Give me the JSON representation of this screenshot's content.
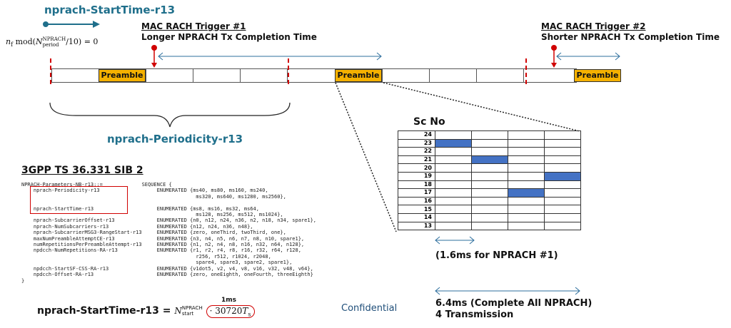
{
  "start_time": {
    "title": "nprach-StartTime-r13",
    "formula": {
      "lhs_var": "n",
      "lhs_sub": "f",
      "mod_text": "mod",
      "n_sym": "N",
      "n_sup": "NPRACH",
      "n_sub": "period",
      "rhs": "/10) = 0"
    }
  },
  "triggers": [
    {
      "title": "MAC RACH Trigger #1",
      "subtitle": "Longer NPRACH Tx Completion Time"
    },
    {
      "title": "MAC RACH Trigger #2",
      "subtitle": "Shorter NPRACH Tx Completion Time"
    }
  ],
  "timeline": {
    "preamble_label": "Preamble",
    "periodicity_label": "nprach-Periodicity-r13"
  },
  "sib": {
    "title": "3GPP TS 36.331 SIB 2",
    "code_lines": [
      "NPRACH-Parameters-NB-r13::=             SEQUENCE {",
      "    nprach-Periodicity-r13                   ENUMERATED {ms40, ms80, ms160, ms240,",
      "                                                          ms320, ms640, ms1280, ms2560},",
      "",
      "    nprach-StartTime-r13                     ENUMERATED {ms8, ms16, ms32, ms64,",
      "                                                          ms128, ms256, ms512, ms1024},",
      "    nprach-SubcarrierOffset-r13              ENUMERATED {n0, n12, n24, n36, n2, n18, n34, spare1},",
      "    nprach-NumSubcarriers-r13                ENUMERATED {n12, n24, n36, n48},",
      "    nprach-SubcarrierMSG3-RangeStart-r13     ENUMERATED {zero, oneThird, twoThird, one},",
      "    maxNumPreambleAttemptCE-r13              ENUMERATED {n3, n4, n5, n6, n7, n8, n10, spare1},",
      "    numRepetitionsPerPreambleAttempt-r13     ENUMERATED {n1, n2, n4, n8, n16, n32, n64, n128},",
      "    npdcch-NumRepetitions-RA-r13             ENUMERATED {r1, r2, r4, r8, r16, r32, r64, r128,",
      "                                                          r256, r512, r1024, r2048,",
      "                                                          spare4, spare3, spare2, spare1},",
      "    npdcch-StartSF-CSS-RA-r13                ENUMERATED {v1dot5, v2, v4, v8, v16, v32, v48, v64},",
      "    npdcch-Offset-RA-r13                     ENUMERATED {zero, oneEighth, oneFourth, threeEighth}",
      "}"
    ]
  },
  "grid": {
    "title": "Sc No",
    "rows": [
      "24",
      "23",
      "22",
      "21",
      "20",
      "19",
      "18",
      "17",
      "16",
      "15",
      "14",
      "13"
    ],
    "filled": [
      [
        1,
        0
      ],
      [
        3,
        1
      ],
      [
        5,
        3
      ],
      [
        7,
        2
      ]
    ]
  },
  "notes": {
    "first": "(1.6ms for NPRACH #1)",
    "all_line1": "6.4ms (Complete All NPRACH)",
    "all_line2": "4 Transmission"
  },
  "bottom_formula": {
    "label": "nprach-StartTime-r13",
    "equals": "=",
    "n_sym": "N",
    "n_sup": "NPRACH",
    "n_sub": "start",
    "factor": "· 30720",
    "ts": "T",
    "ts_sub": "s",
    "unit_above": "1ms"
  },
  "confidential": "Confidential",
  "colors": {
    "teal": "#1f6f8b",
    "preamble": "#f5b100",
    "marker_red": "#d00000",
    "arrow_blue": "#2e6f9e",
    "grid_fill": "#4472c4"
  }
}
